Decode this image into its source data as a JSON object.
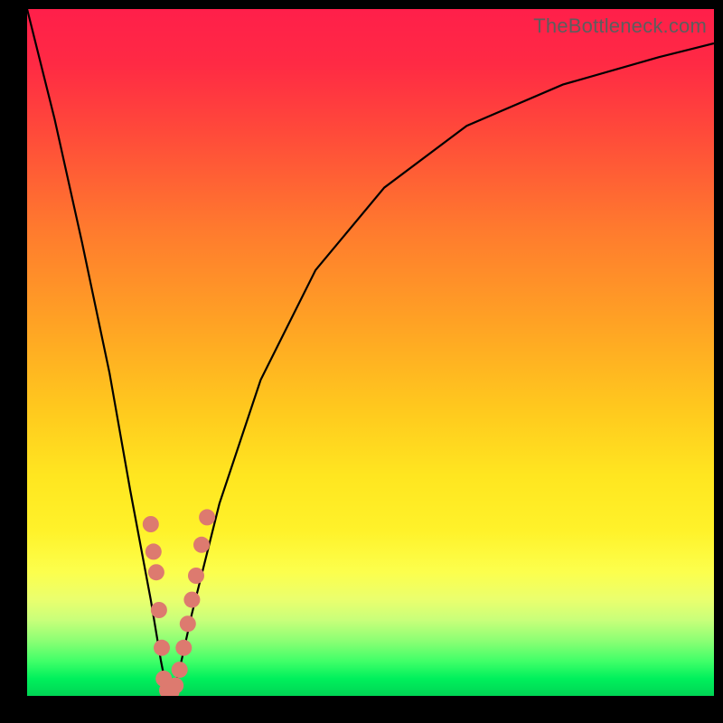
{
  "watermark": "TheBottleneck.com",
  "colors": {
    "frame": "#000000",
    "curve": "#000000",
    "dot": "#dd7a6f"
  },
  "chart_data": {
    "type": "line",
    "title": "",
    "xlabel": "",
    "ylabel": "",
    "xlim": [
      0,
      100
    ],
    "ylim": [
      0,
      100
    ],
    "grid": false,
    "legend": false,
    "series": [
      {
        "name": "bottleneck-curve",
        "x": [
          0,
          4,
          8,
          12,
          15,
          18,
          19.5,
          20.3,
          21,
          22,
          24,
          28,
          34,
          42,
          52,
          64,
          78,
          92,
          100
        ],
        "y": [
          100,
          84,
          66,
          47,
          30,
          14,
          5,
          1,
          0.5,
          3,
          12,
          28,
          46,
          62,
          74,
          83,
          89,
          93,
          95
        ]
      }
    ],
    "markers": [
      {
        "x": 18.0,
        "y": 25.0
      },
      {
        "x": 18.4,
        "y": 21.0
      },
      {
        "x": 18.8,
        "y": 18.0
      },
      {
        "x": 19.2,
        "y": 12.5
      },
      {
        "x": 19.6,
        "y": 7.0
      },
      {
        "x": 19.9,
        "y": 2.5
      },
      {
        "x": 20.4,
        "y": 0.8
      },
      {
        "x": 21.0,
        "y": 0.6
      },
      {
        "x": 21.6,
        "y": 1.5
      },
      {
        "x": 22.2,
        "y": 3.8
      },
      {
        "x": 22.8,
        "y": 7.0
      },
      {
        "x": 23.4,
        "y": 10.5
      },
      {
        "x": 24.0,
        "y": 14.0
      },
      {
        "x": 24.6,
        "y": 17.5
      },
      {
        "x": 25.4,
        "y": 22.0
      },
      {
        "x": 26.2,
        "y": 26.0
      }
    ],
    "marker_radius": 9
  }
}
